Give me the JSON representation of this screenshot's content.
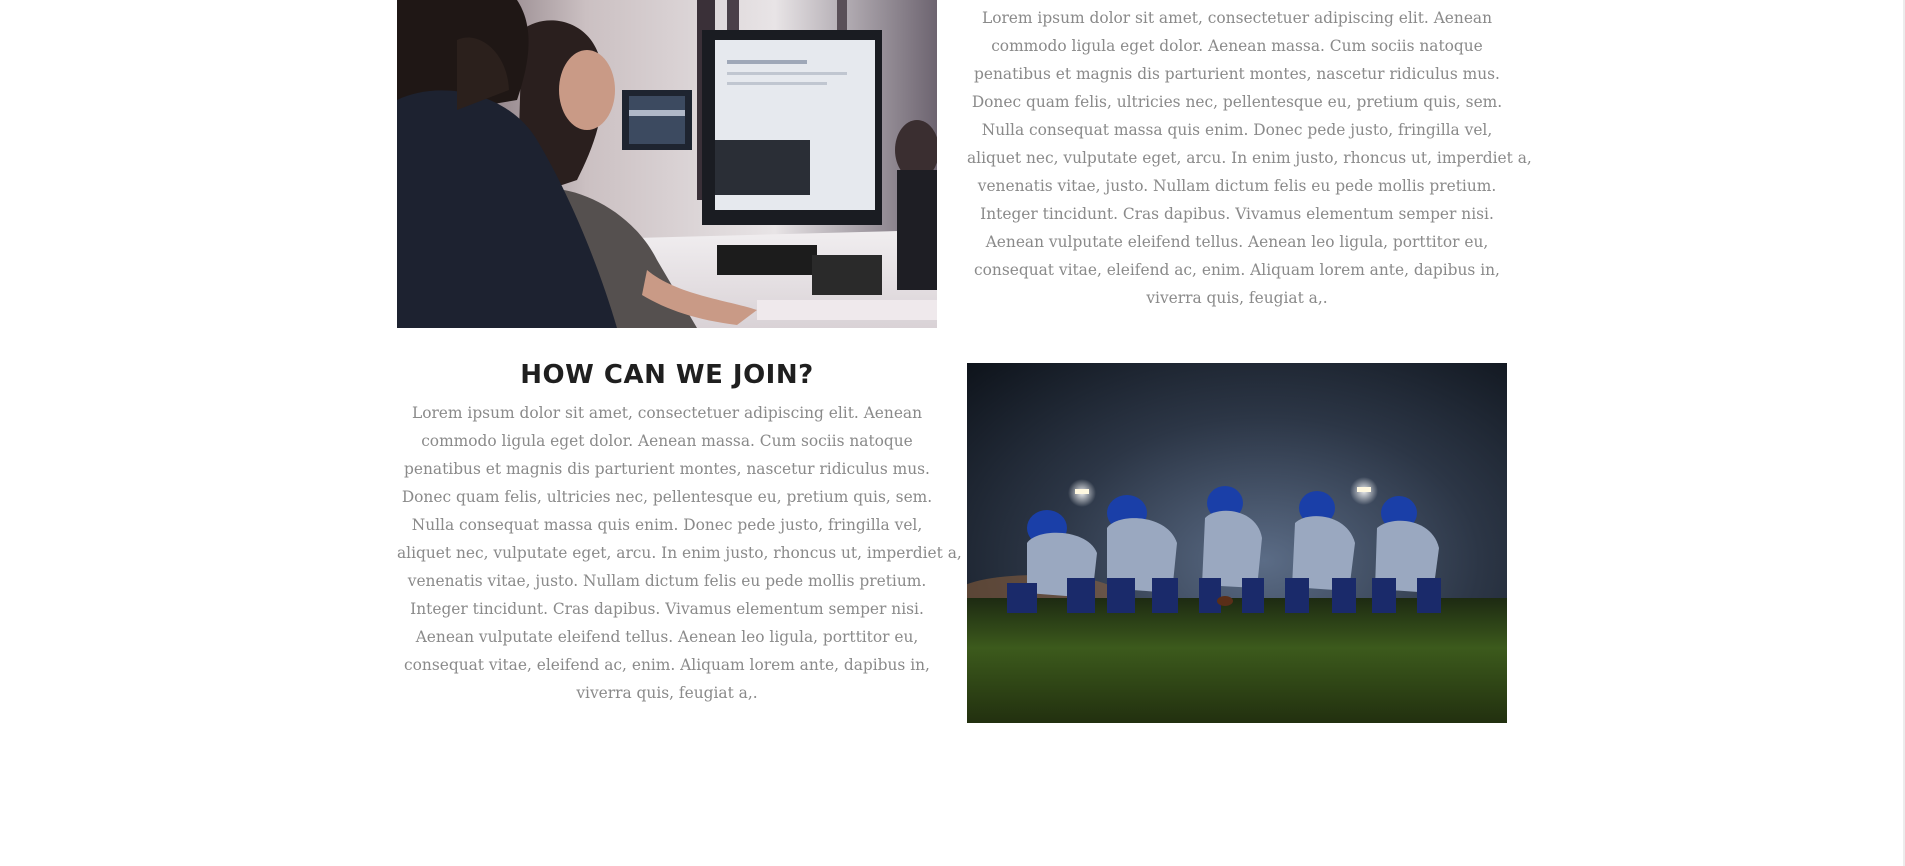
{
  "section_top": {
    "image": "office-workers-at-computers-photo",
    "paragraph_lines": [
      "Lorem ipsum dolor sit amet, consectetuer adipiscing elit. Aenean",
      "commodo ligula eget dolor. Aenean massa. Cum sociis natoque",
      "penatibus et magnis dis parturient montes, nascetur ridiculus mus.",
      "Donec quam felis, ultricies nec, pellentesque eu, pretium quis, sem.",
      "Nulla consequat massa quis enim. Donec pede justo, fringilla vel,",
      "aliquet nec, vulputate eget, arcu. In enim justo, rhoncus ut, imperdiet a,",
      "venenatis vitae, justo. Nullam dictum felis eu pede mollis pretium.",
      "Integer tincidunt. Cras dapibus. Vivamus elementum semper nisi.",
      "Aenean vulputate eleifend tellus. Aenean leo ligula, porttitor eu,",
      "consequat vitae, eleifend ac, enim. Aliquam lorem ante, dapibus in,",
      "viverra quis, feugiat a,."
    ]
  },
  "section_join": {
    "heading": "HOW CAN WE JOIN?",
    "image": "football-players-lineup-photo",
    "paragraph_lines": [
      "Lorem ipsum dolor sit amet, consectetuer adipiscing elit. Aenean",
      "commodo ligula eget dolor. Aenean massa. Cum sociis natoque",
      "penatibus et magnis dis parturient montes, nascetur ridiculus mus.",
      "Donec quam felis, ultricies nec, pellentesque eu, pretium quis, sem.",
      "Nulla consequat massa quis enim. Donec pede justo, fringilla vel,",
      "aliquet nec, vulputate eget, arcu. In enim justo, rhoncus ut, imperdiet a,",
      "venenatis vitae, justo. Nullam dictum felis eu pede mollis pretium.",
      "Integer tincidunt. Cras dapibus. Vivamus elementum semper nisi.",
      "Aenean vulputate eleifend tellus. Aenean leo ligula, porttitor eu,",
      "consequat vitae, eleifend ac, enim. Aliquam lorem ante, dapibus in,",
      "viverra quis, feugiat a,."
    ]
  },
  "colors": {
    "body_text": "#8a8a8a",
    "heading_text": "#1f1f1f",
    "background": "#ffffff"
  }
}
